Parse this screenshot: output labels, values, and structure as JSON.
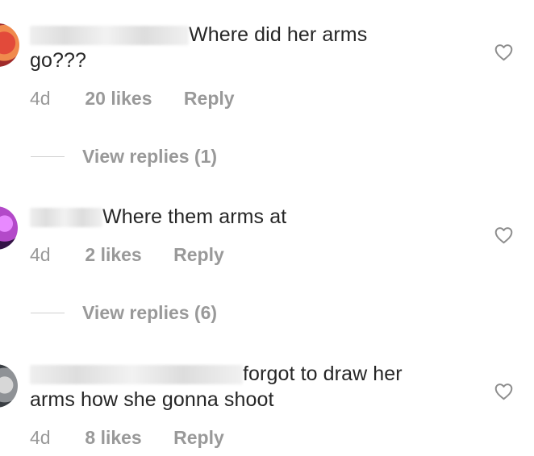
{
  "comments": [
    {
      "text_part_1": "Where did her arms",
      "text_part_2": "go???",
      "age": "4d",
      "likes": "20 likes",
      "reply": "Reply",
      "view_replies": "View replies (1)"
    },
    {
      "text_part_1": "Where them arms at",
      "age": "4d",
      "likes": "2 likes",
      "reply": "Reply",
      "view_replies": "View replies (6)"
    },
    {
      "text_part_1": "forgot to draw her",
      "text_part_2": "arms how she gonna shoot",
      "age": "4d",
      "likes": "8 likes",
      "reply": "Reply"
    }
  ],
  "icons": {
    "like": "heart-outline-icon"
  },
  "colors": {
    "text": "#262626",
    "secondary_text": "#999999",
    "heart_stroke": "#8e8e8e"
  }
}
